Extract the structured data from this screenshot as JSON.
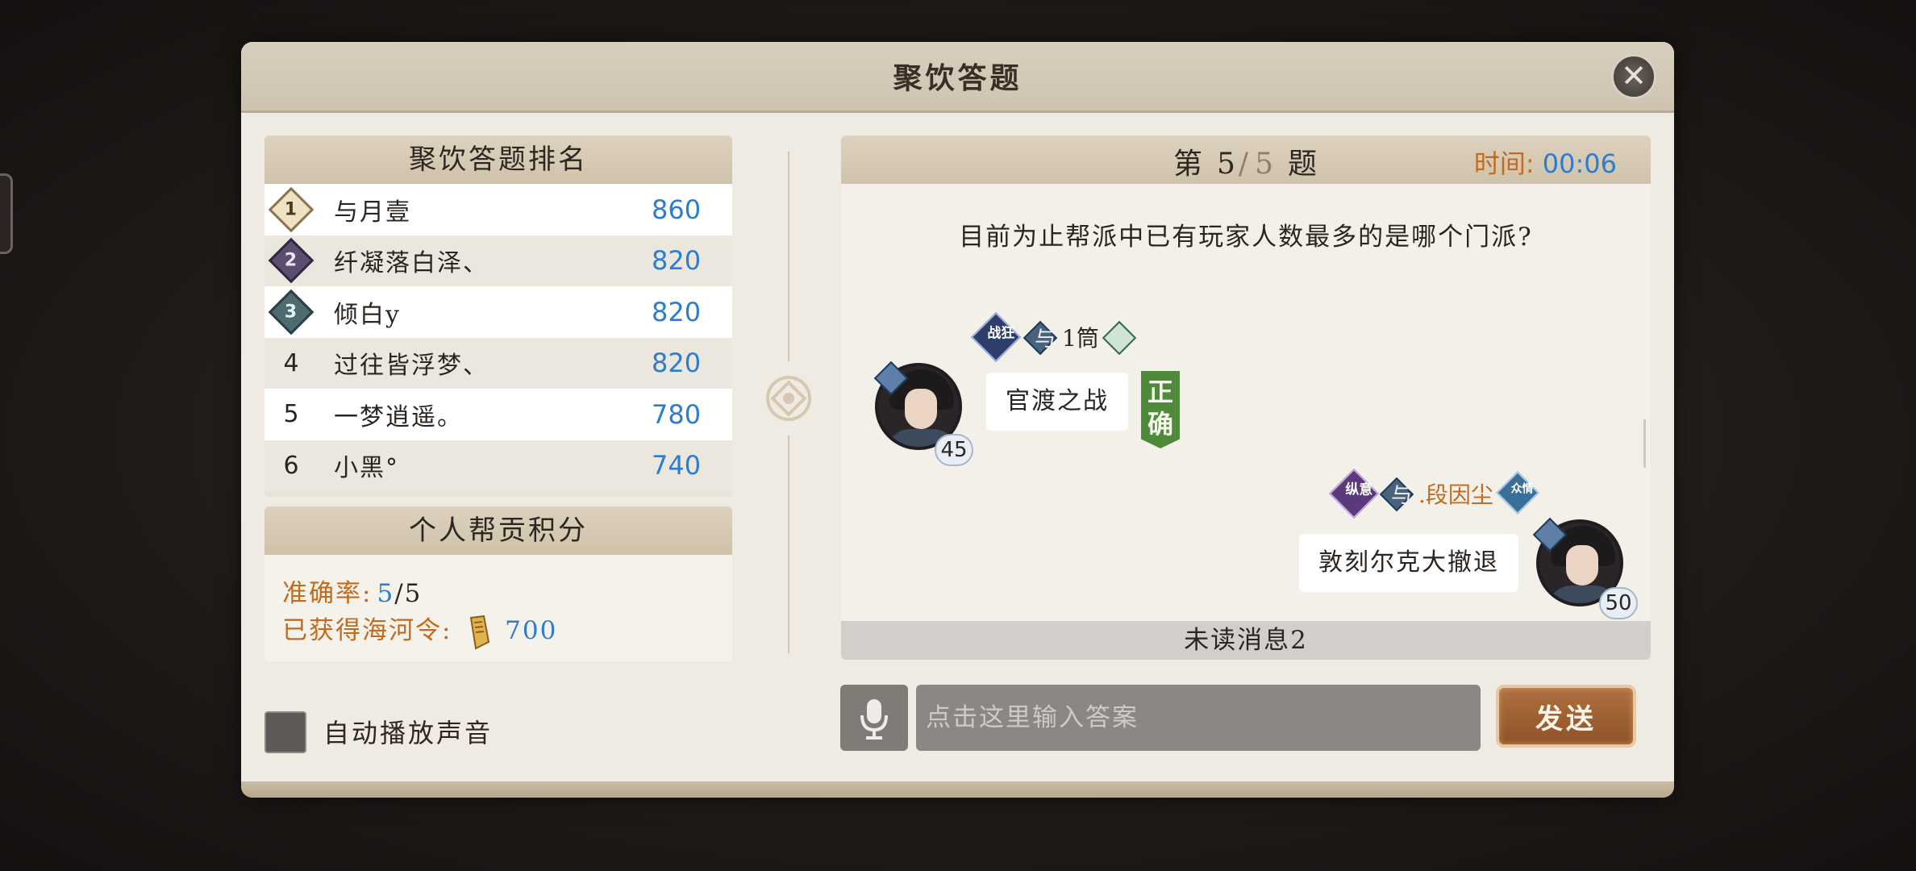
{
  "dialog": {
    "title": "聚饮答题",
    "close_label": "✕"
  },
  "ranking": {
    "title": "聚饮答题排名",
    "rows": [
      {
        "rank": "1",
        "name": "与月壹",
        "score": "860"
      },
      {
        "rank": "2",
        "name": "纤凝落白泽、",
        "score": "820"
      },
      {
        "rank": "3",
        "name": "倾白y",
        "score": "820"
      },
      {
        "rank": "4",
        "name": "过往皆浮梦、",
        "score": "820"
      },
      {
        "rank": "5",
        "name": "一梦逍遥。",
        "score": "780"
      },
      {
        "rank": "6",
        "name": "小黑°",
        "score": "740"
      }
    ]
  },
  "personal": {
    "title": "个人帮贡积分",
    "accuracy_label": "准确率:",
    "accuracy_value": "5",
    "accuracy_sep": "/",
    "accuracy_total": "5",
    "token_label": "已获得海河令:",
    "token_value": "700"
  },
  "auto_play": {
    "label": "自动播放声音",
    "checked": false
  },
  "quiz": {
    "prefix": "第",
    "current": "5",
    "sep": "/",
    "total": "5",
    "suffix": "题",
    "time_label": "时间:",
    "time_value": "00:06",
    "question": "目前为止帮派中已有玩家人数最多的是哪个门派?"
  },
  "messages": [
    {
      "side": "left",
      "badge": "战狂",
      "tag": "与",
      "sender": "1筒",
      "level": "45",
      "text": "官渡之战",
      "result": "正确"
    },
    {
      "side": "right",
      "badge": "纵意",
      "tag": "与",
      "sender": ".段因尘",
      "badge2": "众情",
      "level": "50",
      "text": "敦刻尔克大撤退"
    }
  ],
  "unread": "未读消息2",
  "input": {
    "placeholder": "点击这里输入答案",
    "send_label": "发送"
  },
  "colors": {
    "accent_orange": "#c46a1c",
    "accent_blue": "#2a7dd0",
    "correct_green": "#4e8a3a",
    "send_brown": "#9b5f32"
  },
  "icons": {
    "close": "close-icon",
    "mic": "microphone-icon",
    "token": "token-icon",
    "ornament": "ornament-icon"
  }
}
